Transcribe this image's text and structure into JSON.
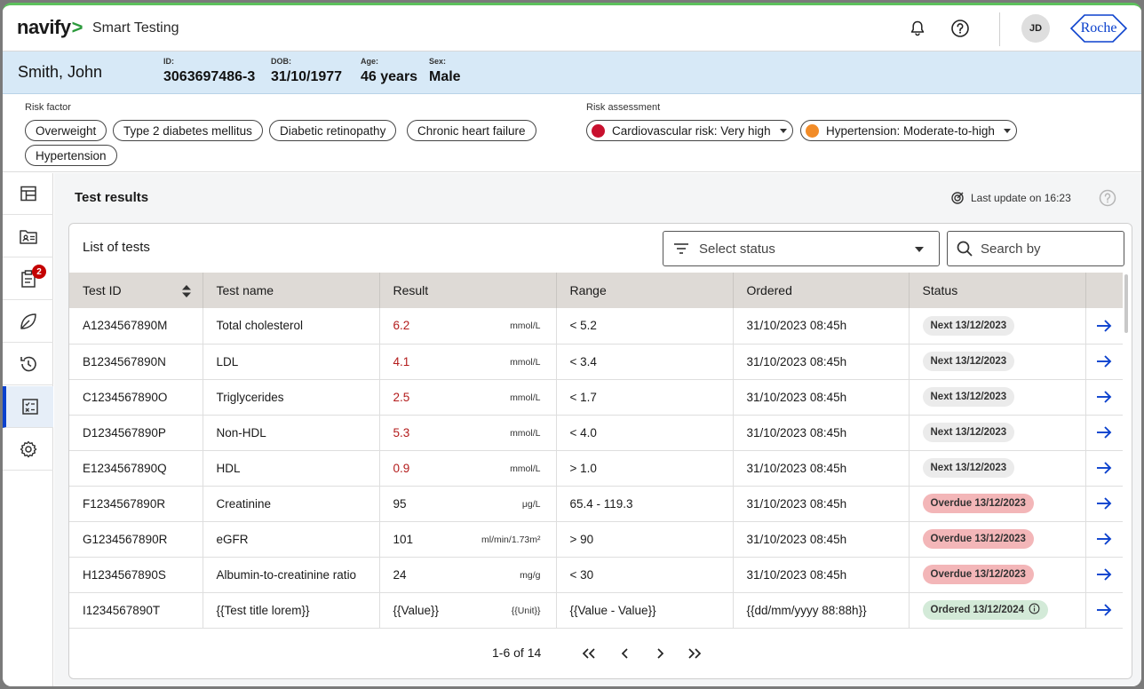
{
  "app": {
    "logo_text": "navify",
    "logo_chevron": ">",
    "product_name": "Smart Testing",
    "user_initials": "JD",
    "brand_text": "Roche",
    "accent_color": "#0b41cd",
    "icons": [
      "bell-icon",
      "help-icon"
    ]
  },
  "patient": {
    "name": "Smith,  John",
    "id_label": "ID:",
    "id_value": "3063697486-3",
    "dob_label": "DOB:",
    "dob_value": "31/10/1977",
    "age_label": "Age:",
    "age_value": "46 years",
    "sex_label": "Sex:",
    "sex_value": "Male"
  },
  "risk_factor": {
    "label": "Risk factor",
    "chips": [
      "Overweight",
      "Type 2 diabetes mellitus",
      "Diabetic retinopathy",
      "Chronic heart failure",
      "Hypertension"
    ]
  },
  "risk_assessment": {
    "label": "Risk assessment",
    "items": [
      {
        "label": "Cardiovascular risk: Very high",
        "color": "#c8102e"
      },
      {
        "label": "Hypertension: Moderate-to-high",
        "color": "#f28c28"
      }
    ]
  },
  "sidebar": {
    "items": [
      {
        "name": "dashboard-icon"
      },
      {
        "name": "patient-card-icon"
      },
      {
        "name": "clipboard-icon",
        "badge": "2"
      },
      {
        "name": "leaf-icon"
      },
      {
        "name": "history-icon"
      },
      {
        "name": "checklist-icon",
        "active": true
      },
      {
        "name": "settings-icon"
      }
    ]
  },
  "main": {
    "title": "Test results",
    "last_update": "Last update on 16:23"
  },
  "list": {
    "title": "List of tests",
    "status_placeholder": "Select status",
    "search_placeholder": "Search by",
    "columns": [
      "Test ID",
      "Test name",
      "Result",
      "Range",
      "Ordered",
      "Status"
    ],
    "rows": [
      {
        "id": "A1234567890M",
        "name": "Total cholesterol",
        "value": "6.2",
        "high": true,
        "unit": "mmol/L",
        "range": "< 5.2",
        "ordered": "31/10/2023 08:45h",
        "status": "Next  13/12/2023",
        "status_type": "next"
      },
      {
        "id": "B1234567890N",
        "name": "LDL",
        "value": "4.1",
        "high": true,
        "unit": "mmol/L",
        "range": "< 3.4",
        "ordered": "31/10/2023 08:45h",
        "status": "Next  13/12/2023",
        "status_type": "next"
      },
      {
        "id": "C1234567890O",
        "name": "Triglycerides",
        "value": "2.5",
        "high": true,
        "unit": "mmol/L",
        "range": "< 1.7",
        "ordered": "31/10/2023 08:45h",
        "status": "Next  13/12/2023",
        "status_type": "next"
      },
      {
        "id": "D1234567890P",
        "name": "Non-HDL",
        "value": "5.3",
        "high": true,
        "unit": "mmol/L",
        "range": "< 4.0",
        "ordered": "31/10/2023 08:45h",
        "status": "Next  13/12/2023",
        "status_type": "next"
      },
      {
        "id": "E1234567890Q",
        "name": "HDL",
        "value": "0.9",
        "high": true,
        "unit": "mmol/L",
        "range": "> 1.0",
        "ordered": "31/10/2023 08:45h",
        "status": "Next  13/12/2023",
        "status_type": "next"
      },
      {
        "id": "F1234567890R",
        "name": "Creatinine",
        "value": "95",
        "high": false,
        "unit": "μg/L",
        "range": "65.4 - 119.3",
        "ordered": "31/10/2023 08:45h",
        "status": "Overdue 13/12/2023",
        "status_type": "overdue"
      },
      {
        "id": "G1234567890R",
        "name": "eGFR",
        "value": "101",
        "high": false,
        "unit": "ml/min/1.73m²",
        "range": "> 90",
        "ordered": "31/10/2023 08:45h",
        "status": "Overdue 13/12/2023",
        "status_type": "overdue"
      },
      {
        "id": "H1234567890S",
        "name": "Albumin-to-creatinine ratio",
        "value": "24",
        "high": false,
        "unit": "mg/g",
        "range": "< 30",
        "ordered": "31/10/2023 08:45h",
        "status": "Overdue 13/12/2023",
        "status_type": "overdue"
      },
      {
        "id": "I1234567890T",
        "name": "{{Test title lorem}}",
        "value": "{{Value}}",
        "high": false,
        "unit": "{{Unit}}",
        "range": "{{Value - Value}}",
        "ordered": "{{dd/mm/yyyy 88:88h}}",
        "status": "Ordered 13/12/2024",
        "status_type": "ordered"
      }
    ]
  },
  "pagination": {
    "text": "1-6 of 14"
  }
}
